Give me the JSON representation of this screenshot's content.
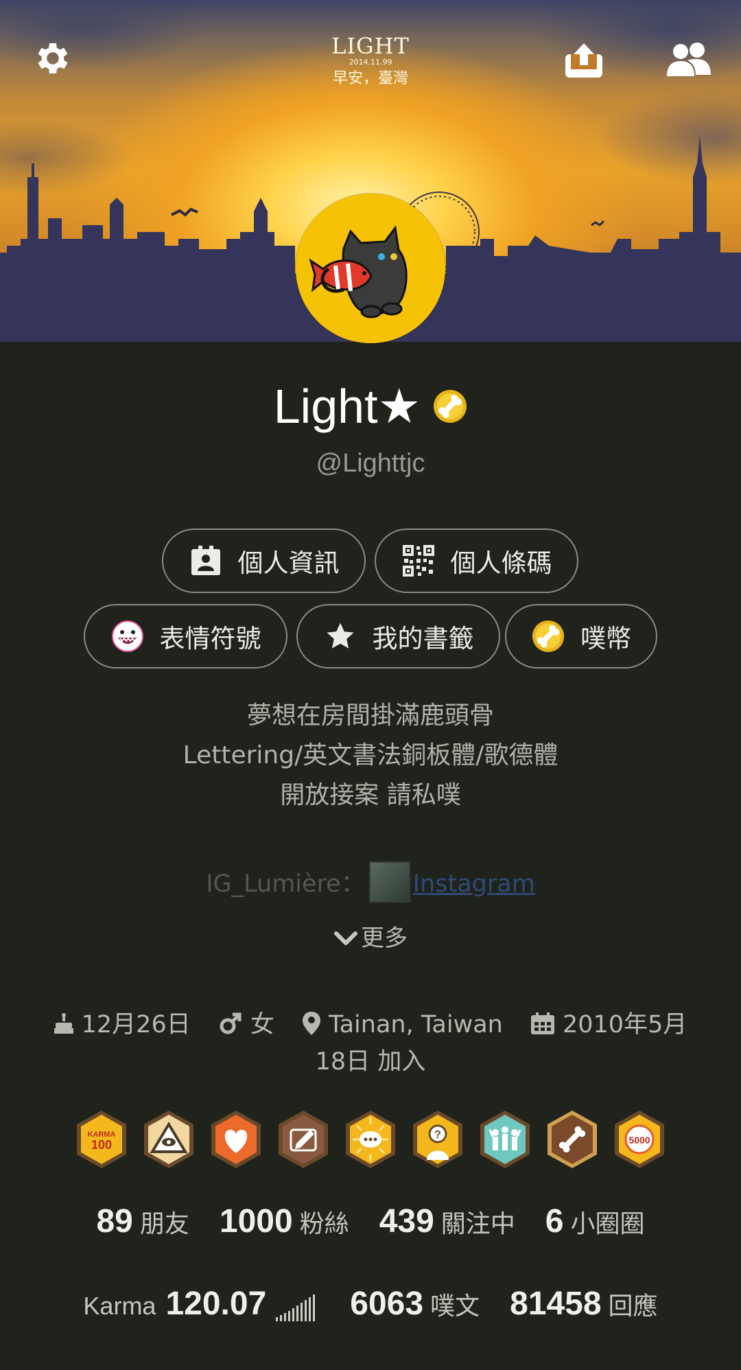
{
  "header": {
    "logo_text": "LIGHT",
    "logo_date": "2014.11.99",
    "greeting": "早安，臺灣"
  },
  "profile": {
    "display_name": "Light★",
    "handle": "@Lighttjc"
  },
  "actions": {
    "personal_info": "個人資訊",
    "personal_qrcode": "個人條碼",
    "emoticons": "表情符號",
    "bookmarks": "我的書籤",
    "coins": "噗幣"
  },
  "bio": {
    "line1": "夢想在房間掛滿鹿頭骨",
    "line2": "Lettering/英文書法銅板體/歌德體",
    "line3": "開放接案 請私噗",
    "ig_label": "IG_Lumière：",
    "ig_link": "Instagram",
    "more_label": "更多"
  },
  "meta": {
    "birthday": "12月26日",
    "gender": "女",
    "location": "Tainan, Taiwan",
    "joined_line1": "2010年5月",
    "joined_line2": "18日 加入"
  },
  "badges": [
    {
      "name": "karma-100-badge",
      "text": "KARMA\n100"
    },
    {
      "name": "eye-badge"
    },
    {
      "name": "heart-badge"
    },
    {
      "name": "pencil-badge"
    },
    {
      "name": "speech-badge"
    },
    {
      "name": "question-badge"
    },
    {
      "name": "crowd-badge"
    },
    {
      "name": "bone-badge"
    },
    {
      "name": "5000-badge",
      "text": "5000"
    }
  ],
  "stats": {
    "friends_count": "89",
    "friends_label": "朋友",
    "fans_count": "1000",
    "fans_label": "粉絲",
    "following_count": "439",
    "following_label": "關注中",
    "cliques_count": "6",
    "cliques_label": "小圈圈",
    "karma_label": "Karma",
    "karma_value": "120.07",
    "plurks_count": "6063",
    "plurks_label": "噗文",
    "responses_count": "81458",
    "responses_label": "回應"
  },
  "colors": {
    "background": "#20221c",
    "avatar_bg": "#f6c206",
    "link": "#2f4b7a"
  }
}
